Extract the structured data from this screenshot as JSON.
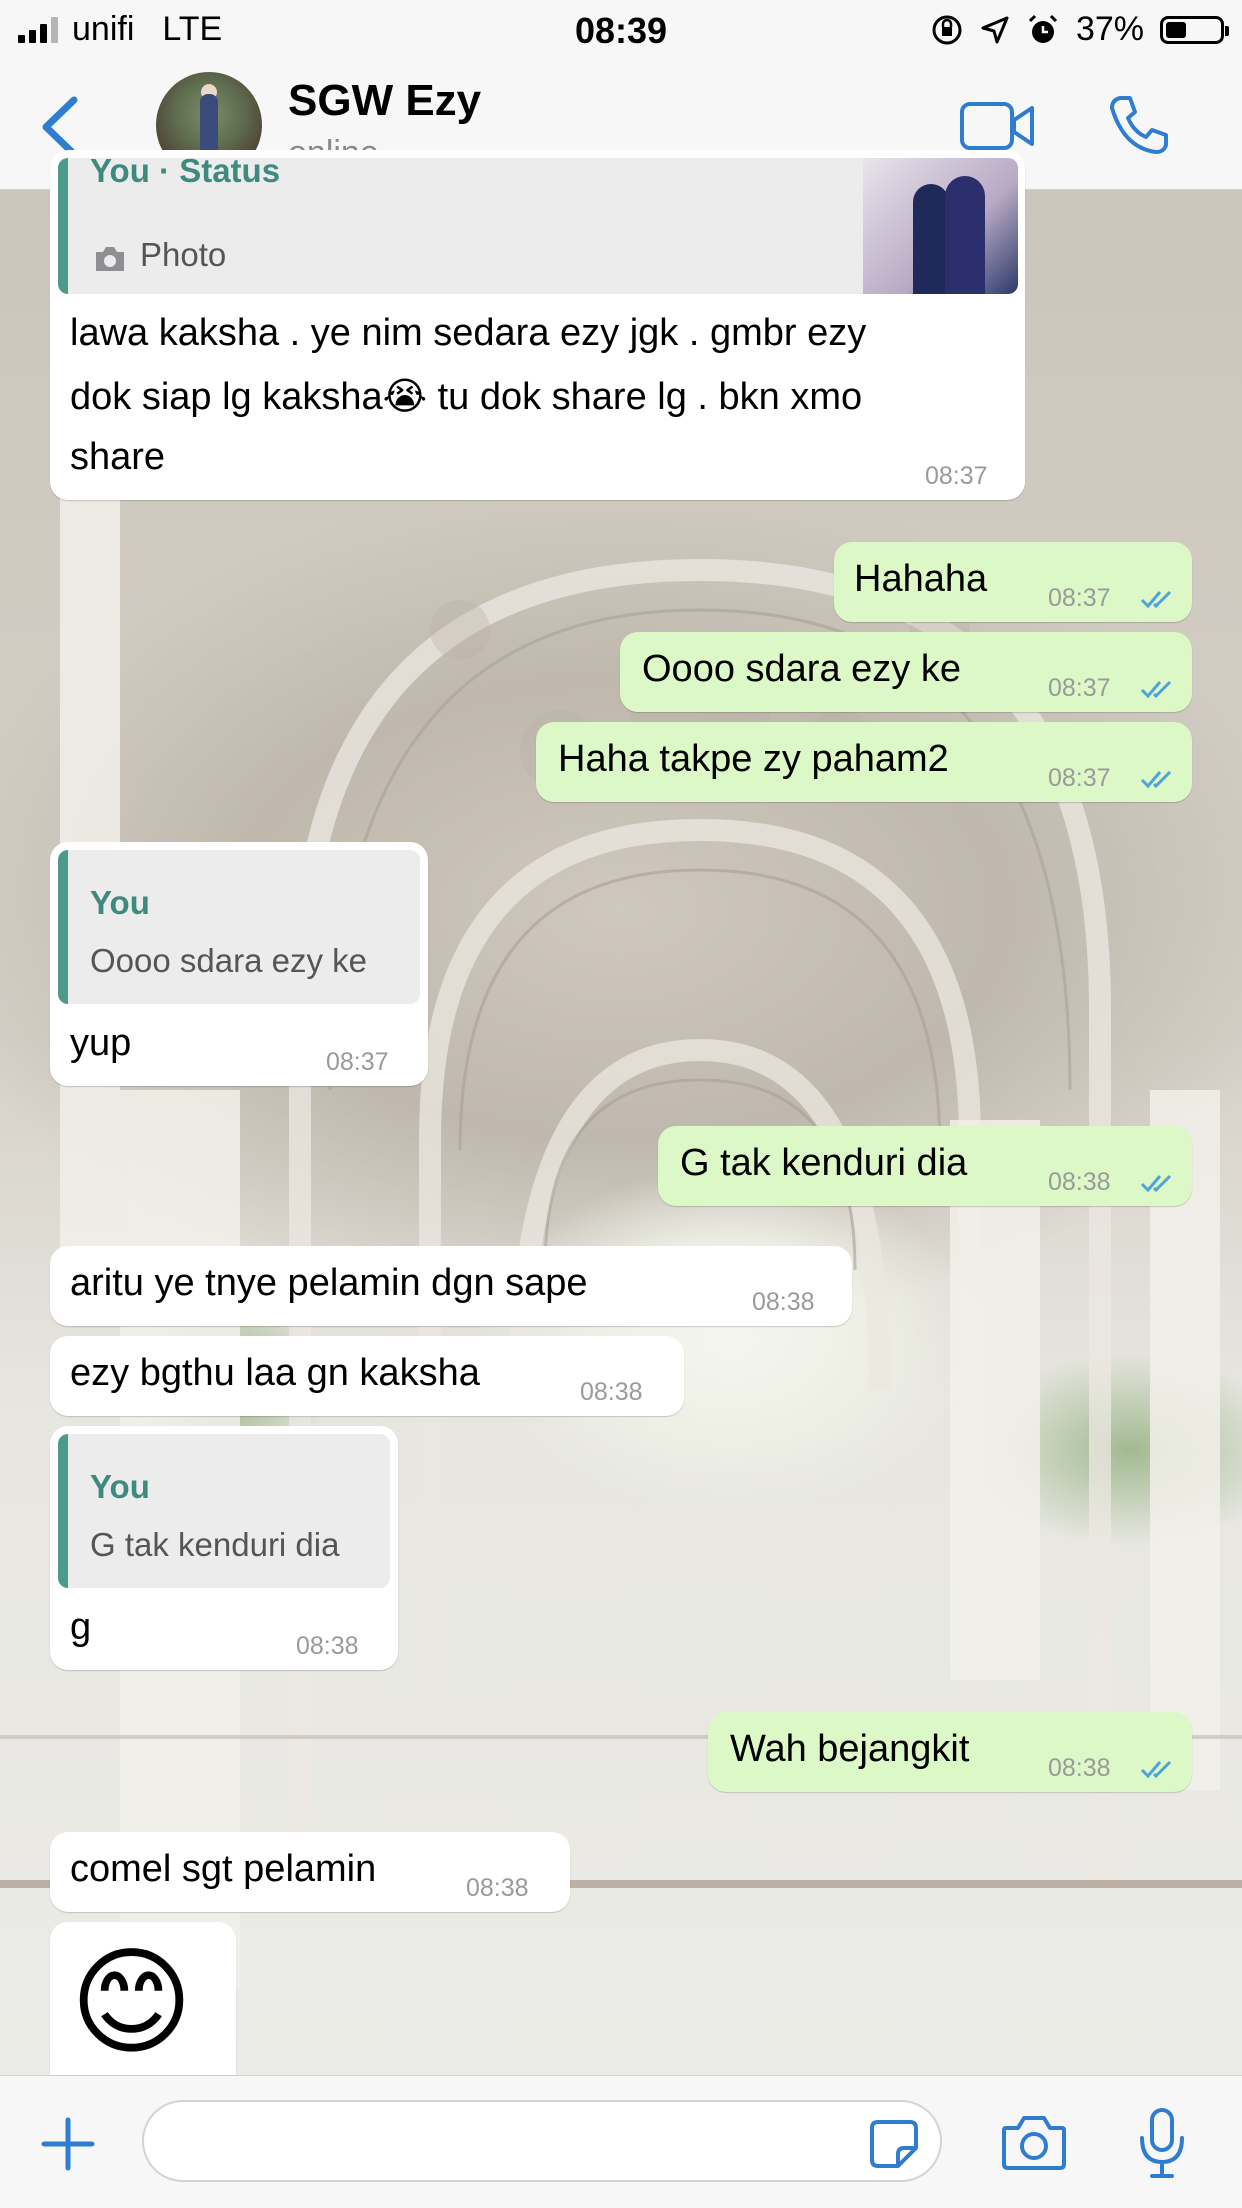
{
  "status_bar": {
    "carrier": "unifi",
    "network": "LTE",
    "time": "08:39",
    "battery": "37%"
  },
  "header": {
    "contact_name": "SGW Ezy",
    "contact_status": "online"
  },
  "icons": {
    "back": "chevron-left-icon",
    "video": "video-call-icon",
    "phone": "phone-icon",
    "add": "plus-icon",
    "sticker": "sticker-icon",
    "camera": "camera-icon",
    "mic": "microphone-icon",
    "accent_color": "#2f7dd1"
  },
  "colors": {
    "incoming_bubble": "#ffffff",
    "outgoing_bubble": "#dcf8c6",
    "quote_accent": "#4e9a8a",
    "read_ticks": "#4fa3d8"
  },
  "messages": [
    {
      "direction": "in",
      "quote_author": "You · Status",
      "quote_text": "Photo",
      "lines": [
        "lawa kaksha . ye nim sedara ezy jgk . gmbr ezy",
        "dok siap lg kaksha😭 tu dok share lg . bkn xmo",
        "share"
      ],
      "time": "08:37"
    },
    {
      "direction": "out",
      "text": "Hahaha",
      "time": "08:37"
    },
    {
      "direction": "out",
      "text": "Oooo sdara ezy ke",
      "time": "08:37"
    },
    {
      "direction": "out",
      "text": "Haha takpe zy paham2",
      "time": "08:37"
    },
    {
      "direction": "in",
      "quote_author": "You",
      "quote_text": "Oooo sdara ezy ke",
      "text": "yup",
      "time": "08:37"
    },
    {
      "direction": "out",
      "text": "G tak kenduri dia",
      "time": "08:38"
    },
    {
      "direction": "in",
      "text": "aritu ye tnye pelamin dgn sape",
      "time": "08:38"
    },
    {
      "direction": "in",
      "text": "ezy bgthu laa gn kaksha",
      "time": "08:38"
    },
    {
      "direction": "in",
      "quote_author": "You",
      "quote_text": "G tak kenduri dia",
      "text": "g",
      "time": "08:38"
    },
    {
      "direction": "out",
      "text": "Wah bejangkit",
      "time": "08:38"
    },
    {
      "direction": "in",
      "text": "comel sgt pelamin",
      "time": "08:38"
    },
    {
      "direction": "in",
      "emoji": "😊"
    }
  ]
}
